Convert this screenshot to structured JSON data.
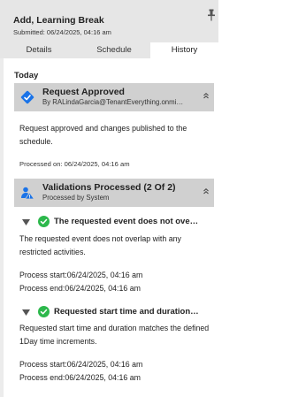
{
  "header": {
    "title": "Add, Learning Break",
    "submitted": "Submitted: 06/24/2025, 04:16 am",
    "pin_icon": "pin-icon"
  },
  "tabs": [
    {
      "label": "Details",
      "active": false
    },
    {
      "label": "Schedule",
      "active": false
    },
    {
      "label": "History",
      "active": true
    }
  ],
  "history": {
    "group_label": "Today",
    "request_approved": {
      "title": "Request Approved",
      "by": "By RALindaGarcia@TenantEverything.onmi…",
      "icon": "diamond-arrow-icon",
      "icon_color": "#1a73e8",
      "message": "Request approved and changes published to the schedule.",
      "processed_on": "Processed on:  06/24/2025, 04:16 am"
    },
    "validations": {
      "title": "Validations Processed (2 Of 2)",
      "by": "Processed by System",
      "icon": "person-alert-icon",
      "icon_color": "#1a73e8",
      "items": [
        {
          "title": "The requested event does not ove…",
          "message": "The requested event does not overlap with any restricted activities.",
          "start": "Process start:06/24/2025, 04:16 am",
          "end": "Process end:06/24/2025, 04:16 am",
          "status_color": "#2db84c"
        },
        {
          "title": "Requested start time and duration…",
          "message": "Requested start time and duration matches the defined 1Day time increments.",
          "start": "Process start:06/24/2025, 04:16 am",
          "end": "Process end:06/24/2025, 04:16 am",
          "status_color": "#2db84c"
        }
      ]
    }
  },
  "colors": {
    "header_bg": "#e6e6e6",
    "card_header_bg": "#d0d0d0",
    "accent": "#1a73e8",
    "success": "#2db84c"
  }
}
